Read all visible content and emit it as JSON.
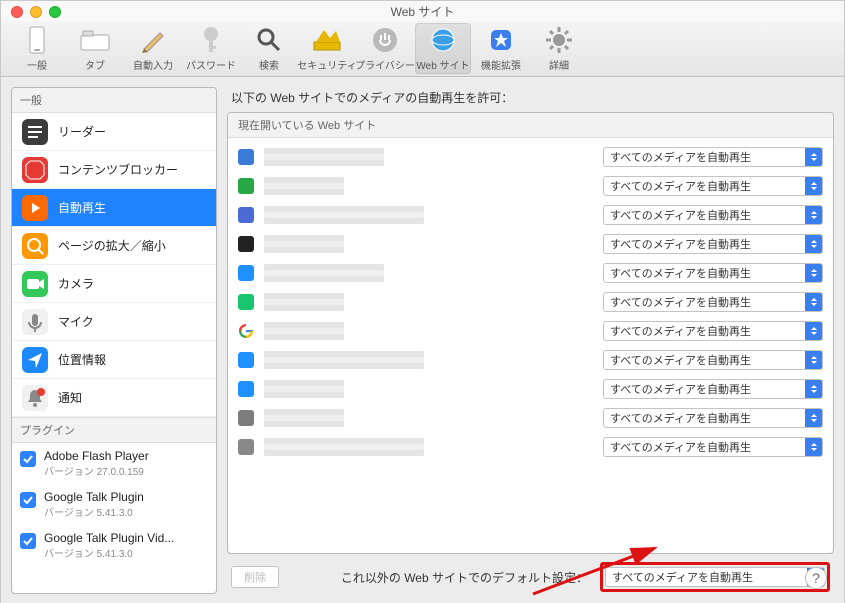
{
  "window": {
    "title": "Web サイト"
  },
  "toolbar": [
    {
      "name": "general",
      "label": "一般"
    },
    {
      "name": "tabs",
      "label": "タブ"
    },
    {
      "name": "autofill",
      "label": "自動入力"
    },
    {
      "name": "passwords",
      "label": "パスワード"
    },
    {
      "name": "search",
      "label": "検索"
    },
    {
      "name": "security",
      "label": "セキュリティ"
    },
    {
      "name": "privacy",
      "label": "プライバシー"
    },
    {
      "name": "websites",
      "label": "Web サイト",
      "selected": true
    },
    {
      "name": "extensions",
      "label": "機能拡張"
    },
    {
      "name": "advanced",
      "label": "詳細"
    }
  ],
  "sidebar": {
    "header_general": "一般",
    "header_plugins": "プラグイン",
    "items": [
      {
        "name": "reader",
        "label": "リーダー",
        "icon": "reader",
        "selected": false
      },
      {
        "name": "content-blockers",
        "label": "コンテンツブロッカー",
        "icon": "stop",
        "selected": false
      },
      {
        "name": "autoplay",
        "label": "自動再生",
        "icon": "play",
        "selected": true
      },
      {
        "name": "page-zoom",
        "label": "ページの拡大／縮小",
        "icon": "zoom",
        "selected": false
      },
      {
        "name": "camera",
        "label": "カメラ",
        "icon": "camera",
        "selected": false
      },
      {
        "name": "microphone",
        "label": "マイク",
        "icon": "mic",
        "selected": false
      },
      {
        "name": "location",
        "label": "位置情報",
        "icon": "location",
        "selected": false
      },
      {
        "name": "notifications",
        "label": "通知",
        "icon": "bell",
        "selected": false
      }
    ],
    "plugins": [
      {
        "name": "Adobe Flash Player",
        "version": "バージョン 27.0.0.159",
        "checked": true
      },
      {
        "name": "Google Talk Plugin",
        "version": "バージョン 5.41.3.0",
        "checked": true
      },
      {
        "name": "Google Talk Plugin Vid...",
        "version": "バージョン 5.41.3.0",
        "checked": true
      }
    ]
  },
  "main": {
    "header": "以下の Web サイトでのメディアの自動再生を許可：",
    "subheader": "現在開いている Web サイト",
    "option_label": "すべてのメディアを自動再生",
    "remove_button": "削除",
    "default_label": "これ以外の Web サイトでのデフォルト設定：",
    "sites": [
      {
        "favicon": "#3a7bd5",
        "host_width": "med"
      },
      {
        "favicon": "#28a745",
        "host_width": "short"
      },
      {
        "favicon": "#4a6bd6",
        "host_width": "long"
      },
      {
        "favicon": "#222",
        "host_width": "short"
      },
      {
        "favicon": "#1e90ff",
        "host_width": "med"
      },
      {
        "favicon": "#17c66f",
        "host_width": "short"
      },
      {
        "favicon": "google",
        "host_width": "short"
      },
      {
        "favicon": "#1e90ff",
        "host_width": "long"
      },
      {
        "favicon": "#1e90ff",
        "host_width": "short"
      },
      {
        "favicon": "#7d7d7d",
        "host_width": "short"
      },
      {
        "favicon": "#888",
        "host_width": "long"
      }
    ]
  },
  "help": "?"
}
